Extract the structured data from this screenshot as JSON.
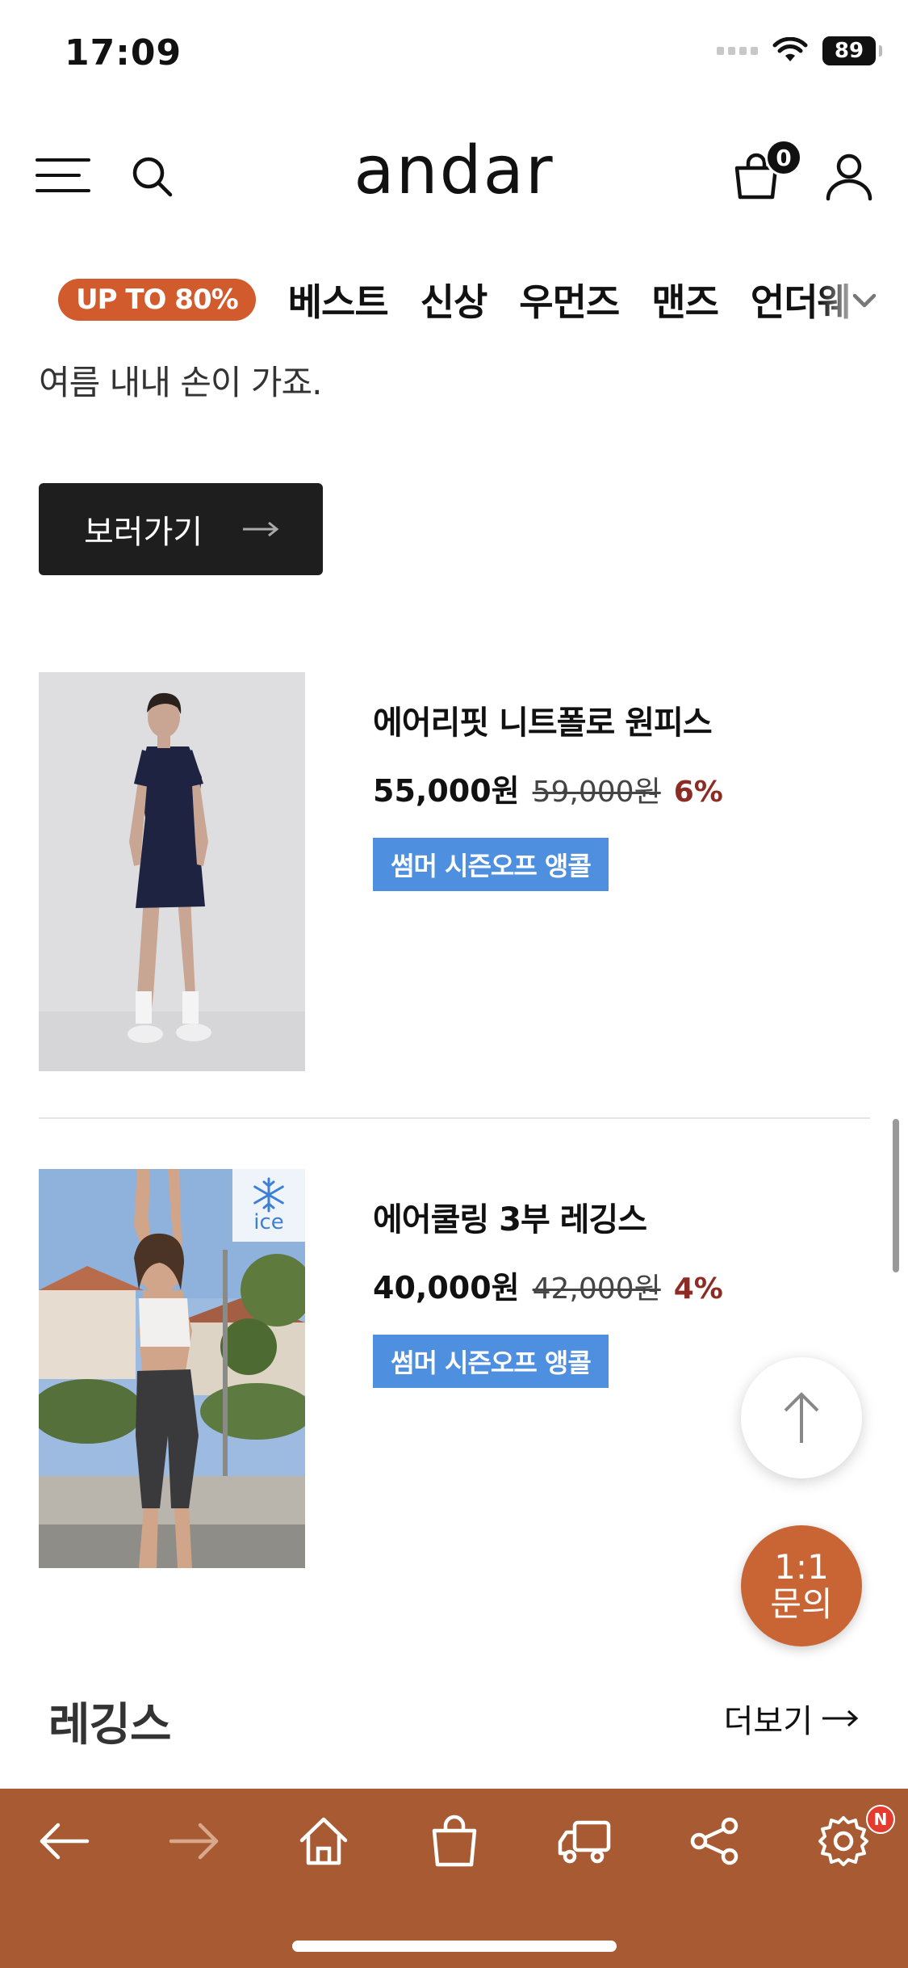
{
  "status_bar": {
    "time": "17:09",
    "battery": "89"
  },
  "header": {
    "logo": "andar",
    "cart_count": "0"
  },
  "nav": {
    "promo": "UP TO 80%",
    "items": [
      "베스트",
      "신상",
      "우먼즈",
      "맨즈",
      "언더웨"
    ]
  },
  "banner": {
    "tagline": "여름 내내 손이 가죠.",
    "button_label": "보러가기"
  },
  "products": [
    {
      "name": "에어리핏 니트폴로 원피스",
      "price": "55,000원",
      "original_price": "59,000원",
      "discount": "6%",
      "badge": "썸머 시즌오프 앵콜"
    },
    {
      "name": "에어쿨링 3부 레깅스",
      "price": "40,000원",
      "original_price": "42,000원",
      "discount": "4%",
      "badge": "썸머 시즌오프 앵콜",
      "image_tag": "ice"
    }
  ],
  "floating": {
    "chat_line1": "1:1",
    "chat_line2": "문의"
  },
  "section": {
    "title": "레깅스",
    "more_label": "더보기"
  },
  "colors": {
    "accent": "#d15b2d",
    "toolbar": "#a85a32",
    "badge": "#4f8fdf",
    "discount": "#8d2b25",
    "chat": "#c96534"
  },
  "toolbar": {
    "icons": [
      "back-arrow-icon",
      "forward-arrow-icon",
      "home-icon",
      "bag-icon",
      "delivery-icon",
      "share-icon",
      "settings-icon"
    ],
    "settings_badge": "N"
  }
}
